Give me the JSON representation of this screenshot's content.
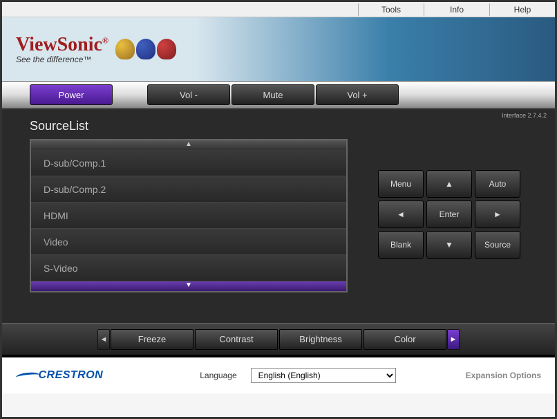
{
  "topmenu": {
    "tools": "Tools",
    "info": "Info",
    "help": "Help"
  },
  "logo": {
    "brand": "ViewSonic",
    "reg": "®",
    "tag": "See the difference™"
  },
  "ctrl": {
    "power": "Power",
    "voldown": "Vol -",
    "mute": "Mute",
    "volup": "Vol +"
  },
  "version": "Interface 2.7.4.2",
  "source": {
    "title": "SourceList",
    "items": [
      "D-sub/Comp.1",
      "D-sub/Comp.2",
      "HDMI",
      "Video",
      "S-Video"
    ]
  },
  "keypad": {
    "menu": "Menu",
    "up": "▲",
    "auto": "Auto",
    "left": "◄",
    "enter": "Enter",
    "right": "►",
    "blank": "Blank",
    "down": "▼",
    "source": "Source"
  },
  "strip": {
    "freeze": "Freeze",
    "contrast": "Contrast",
    "brightness": "Brightness",
    "color": "Color"
  },
  "footer": {
    "crestron": "CRESTRON",
    "lang_label": "Language",
    "lang_value": "English (English)",
    "expansion": "Expansion Options"
  }
}
